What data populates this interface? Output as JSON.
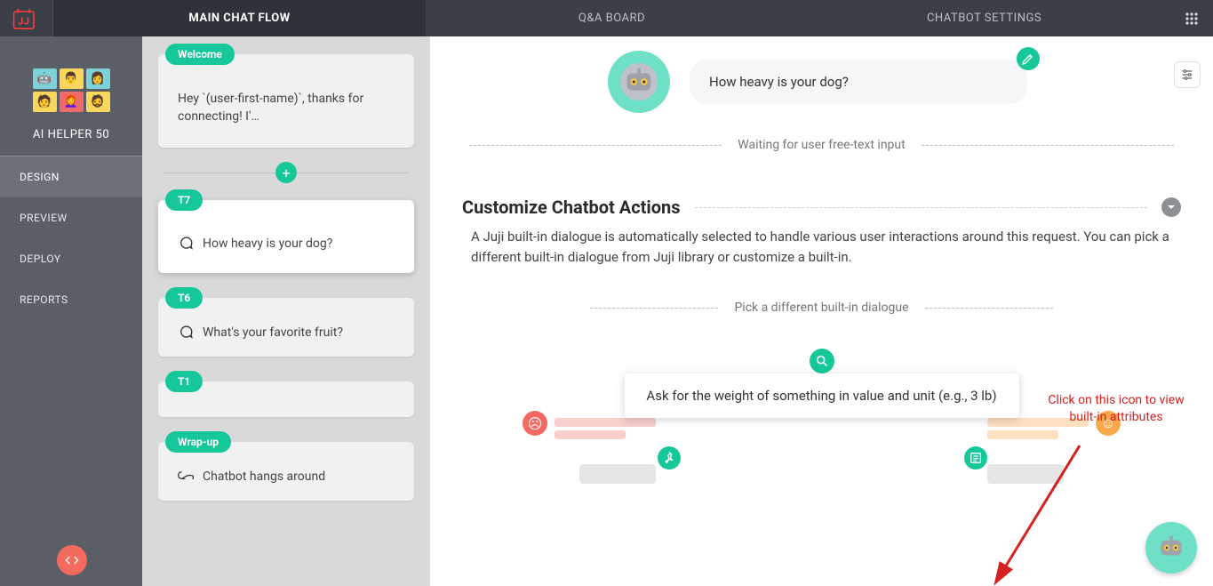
{
  "topbar": {
    "tabs": [
      {
        "label": "MAIN CHAT FLOW",
        "active": true
      },
      {
        "label": "Q&A BOARD",
        "active": false
      },
      {
        "label": "CHATBOT SETTINGS",
        "active": false
      }
    ]
  },
  "sidebar": {
    "bot_name": "AI HELPER 50",
    "nav": [
      {
        "label": "DESIGN",
        "active": true
      },
      {
        "label": "PREVIEW",
        "active": false
      },
      {
        "label": "DEPLOY",
        "active": false
      },
      {
        "label": "REPORTS",
        "active": false
      }
    ]
  },
  "flow": {
    "cards": [
      {
        "pill": "Welcome",
        "text": "Hey `(user-first-name)`, thanks for connecting! I'…"
      },
      {
        "pill": "T7",
        "text": "How heavy is your dog?",
        "selected": true
      },
      {
        "pill": "T6",
        "text": "What's your favorite fruit?"
      },
      {
        "pill": "T1",
        "text": ""
      },
      {
        "pill": "Wrap-up",
        "text": "Chatbot hangs around"
      }
    ]
  },
  "main": {
    "bot_message": "How heavy is your dog?",
    "waiting_label": "Waiting for user free-text input",
    "section_title": "Customize Chatbot Actions",
    "section_desc": "A Juji built-in dialogue is automatically selected to handle various user interactions around this request. You can pick a different built-in dialogue from Juji library or customize a built-in.",
    "subpick_label": "Pick a different built-in dialogue",
    "dialogue_text": "Ask for the weight of something in value and unit (e.g., 3 lb)"
  },
  "annotation": {
    "text": "Click on this icon to view built-in attributes"
  }
}
